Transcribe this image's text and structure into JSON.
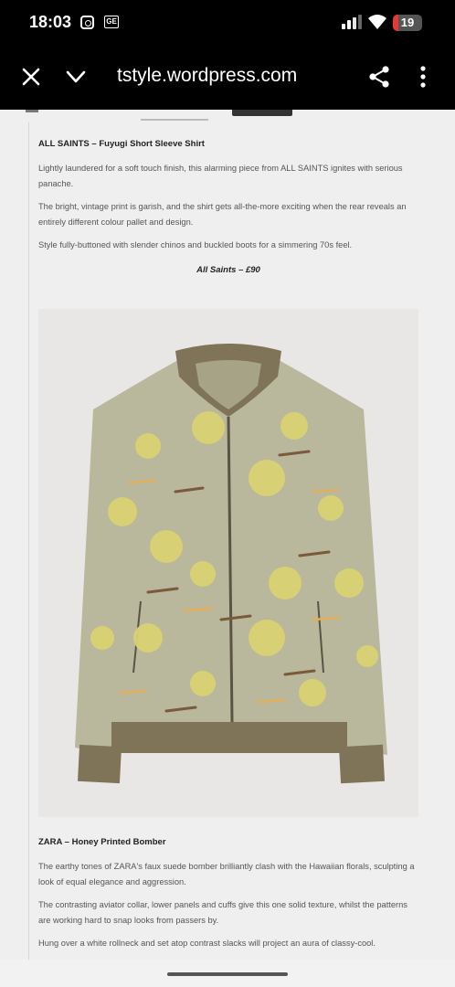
{
  "status_bar": {
    "time": "18:03",
    "notification_icons": [
      "instagram-icon",
      "ge-icon"
    ],
    "ge_label": "GE",
    "battery_level": "19",
    "battery_fraction": 0.19,
    "battery_color": "#e53935"
  },
  "toolbar": {
    "url": "tstyle.wordpress.com",
    "icons": [
      "close-icon",
      "chevron-down-icon",
      "share-icon",
      "more-vert-icon"
    ]
  },
  "article": {
    "item1": {
      "title": "ALL SAINTS – Fuyugi Short Sleeve Shirt",
      "paragraphs": [
        "Lightly laundered for a soft touch finish, this alarming piece from ALL SAINTS ignites with serious panache.",
        "The bright, vintage print is garish, and the shirt gets all-the-more exciting when the rear reveals an entirely different colour pallet and design.",
        "Style fully-buttoned with slender chinos and buckled boots for a simmering 70s feel."
      ],
      "price": "All Saints – £90"
    },
    "item2": {
      "title": "ZARA – Honey Printed Bomber",
      "paragraphs": [
        "The earthy tones of ZARA's faux suede bomber brilliantly clash with the Hawaiian florals, sculpting a look of equal elegance and aggression.",
        "The contrasting aviator collar, lower panels and cuffs give this one solid texture, whilst the patterns are working hard to snap looks from passers by.",
        "Hung over a white rollneck and set atop contrast slacks will project an aura of classy-cool."
      ]
    }
  },
  "colors": {
    "jacket_body": "#b9b79c",
    "jacket_rib": "#7f7458",
    "flower_yellow": "#d9d272",
    "background": "#efefef"
  }
}
